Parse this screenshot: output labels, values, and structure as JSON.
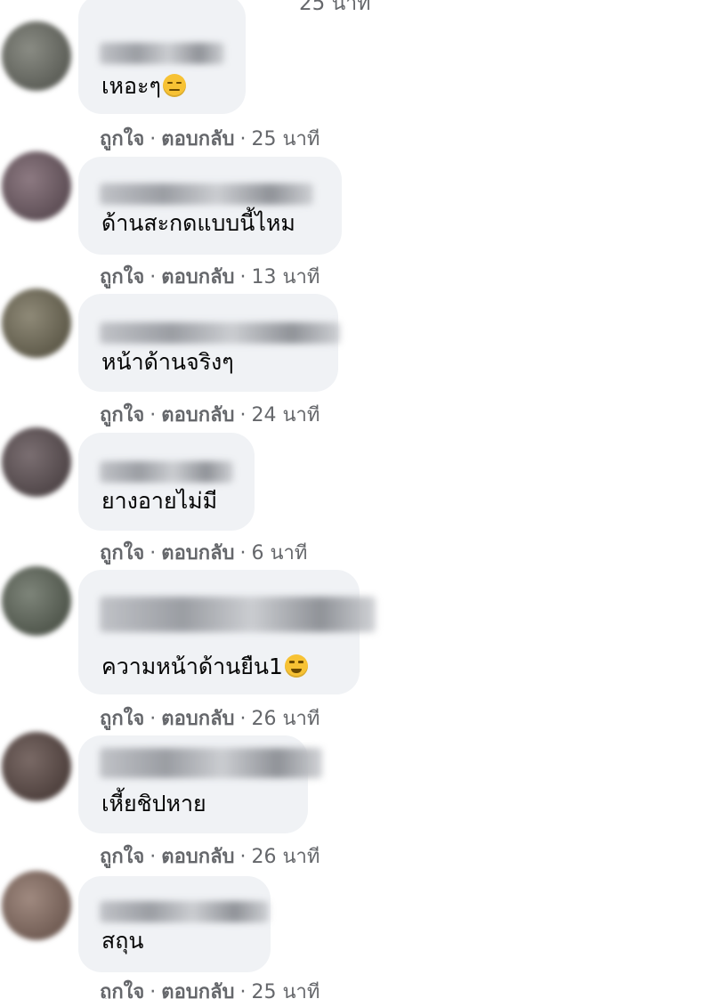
{
  "top_time": "25 นาที",
  "labels": {
    "like": "ถูกใจ",
    "reply": "ตอบกลับ",
    "separator": "·"
  },
  "comments": [
    {
      "text": "เหอะๆ",
      "emoji": "meh",
      "time": "25 นาที"
    },
    {
      "text": "ด้านสะกดแบบนี้ไหม",
      "emoji": "",
      "time": "13 นาที"
    },
    {
      "text": "หน้าด้านจริงๆ",
      "emoji": "",
      "time": "24 นาที"
    },
    {
      "text": "ยางอายไม่มี",
      "emoji": "",
      "time": "6 นาที"
    },
    {
      "text": "ความหน้าด้านยืน1",
      "emoji": "laugh",
      "time": "26 นาที"
    },
    {
      "text": "เหี้ยชิปหาย",
      "emoji": "",
      "time": "26 นาที"
    },
    {
      "text": "สถุน",
      "emoji": "",
      "time": "25 นาที"
    }
  ],
  "colors": {
    "bubble": "#f0f2f5",
    "meta": "#65676b",
    "text": "#050505"
  }
}
